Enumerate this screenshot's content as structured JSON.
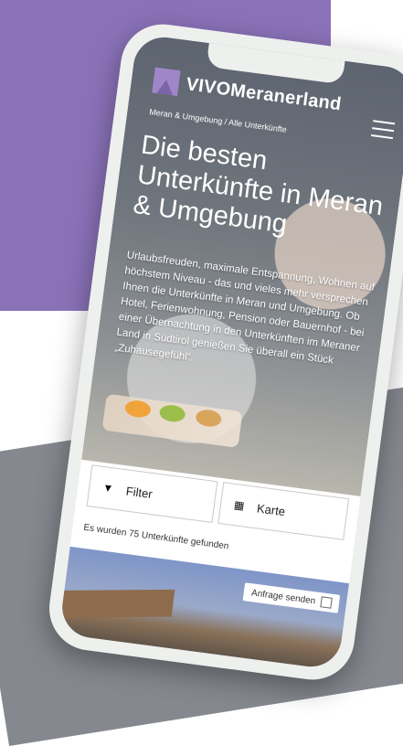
{
  "header": {
    "logo_text": "VIVOMeranerland"
  },
  "breadcrumb": "Meran & Umgebung / Alle Unterkünfte",
  "hero": {
    "title": "Die besten Unterkünfte in Meran & Umgebung",
    "text": "Urlaubsfreuden, maximale Entspannung, Wohnen auf höchstem Niveau - das und vieles mehr versprechen Ihnen die Unterkünfte in Meran und Umgebung. Ob Hotel, Ferienwohnung, Pension oder Bauernhof - bei einer Übernachtung in den Unterkünften im Meraner Land in Südtirol genießen Sie überall ein Stück „Zuhausegefühl“."
  },
  "controls": {
    "filter_label": "Filter",
    "map_label": "Karte"
  },
  "results": {
    "count_text": "Es wurden 75 Unterkünfte gefunden"
  },
  "property": {
    "inquiry_label": "Anfrage senden"
  },
  "colors": {
    "brand_purple": "#8a72b8",
    "background_gray": "#85888f"
  }
}
